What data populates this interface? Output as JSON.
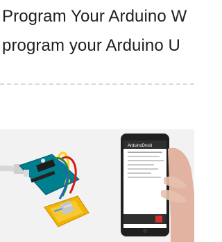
{
  "article": {
    "title_line_1": "Program Your Arduino W",
    "title_line_2": "program your Arduino U"
  },
  "photo": {
    "phone_app_title": "ArduinoDroid",
    "background_color": "#f2f2f2",
    "board_color": "#007f8e",
    "breadboard_color": "#f2b400",
    "phone_color": "#1f1f1f"
  }
}
